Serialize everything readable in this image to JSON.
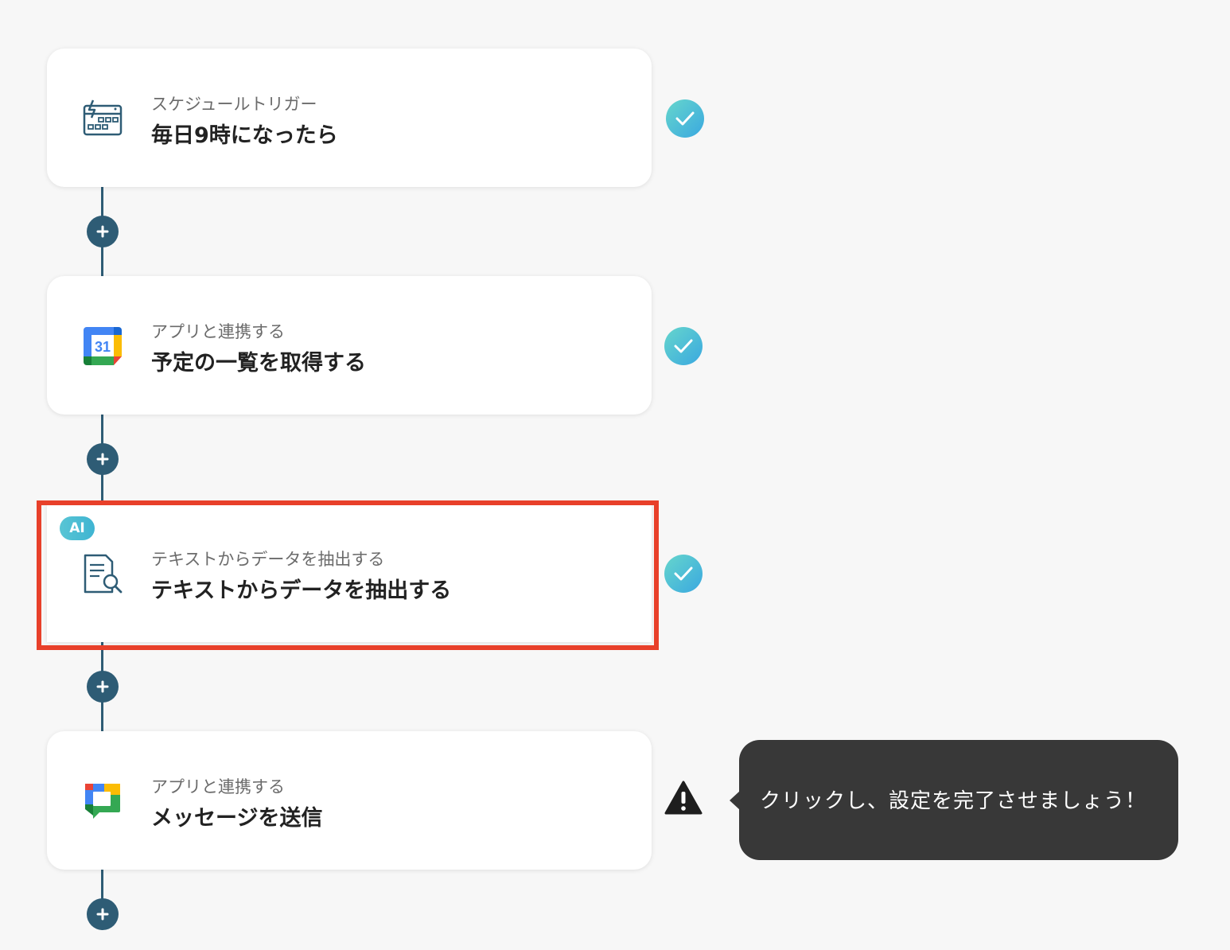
{
  "steps": [
    {
      "subtitle": "スケジュールトリガー",
      "title": "毎日9時になったら",
      "icon": "schedule-trigger-icon",
      "status": "complete"
    },
    {
      "subtitle": "アプリと連携する",
      "title": "予定の一覧を取得する",
      "icon": "google-calendar-icon",
      "icon_text": "31",
      "status": "complete"
    },
    {
      "subtitle": "テキストからデータを抽出する",
      "title": "テキストからデータを抽出する",
      "icon": "document-search-icon",
      "badge": "AI",
      "status": "complete"
    },
    {
      "subtitle": "アプリと連携する",
      "title": "メッセージを送信",
      "icon": "google-chat-icon",
      "status": "warning"
    }
  ],
  "tooltip": {
    "text": "クリックし、設定を完了させましょう！"
  },
  "colors": {
    "connector": "#2e5c75",
    "highlight": "#e8402a",
    "check_start": "#66d6cc",
    "check_end": "#3aa8e0",
    "tooltip_bg": "#383838"
  }
}
